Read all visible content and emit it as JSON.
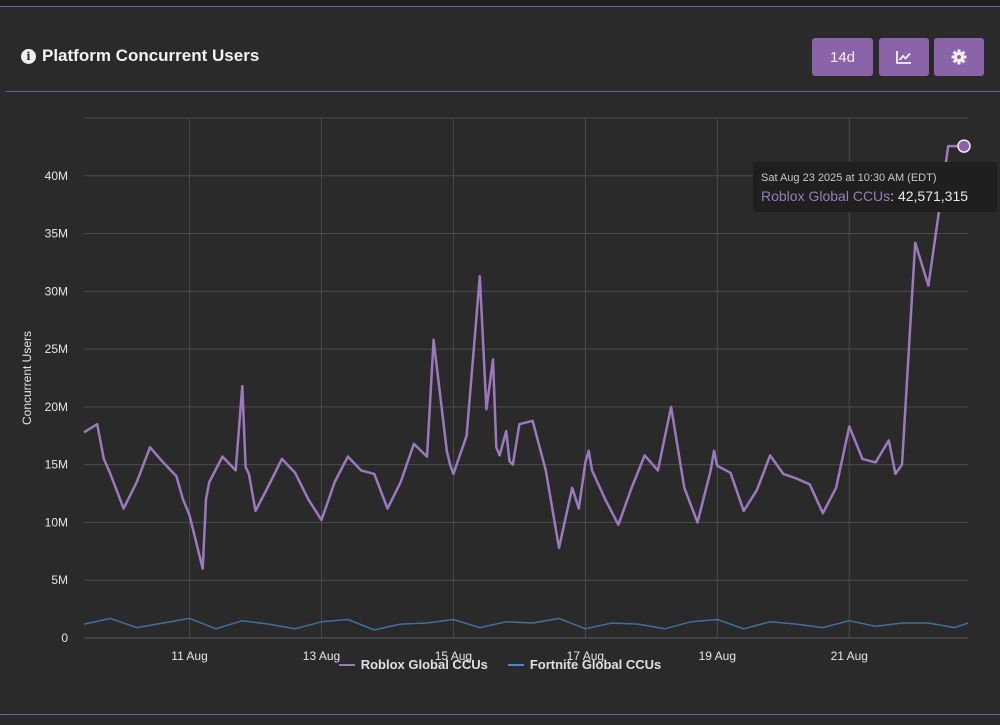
{
  "panel": {
    "title": "Platform Concurrent Users",
    "range_button": "14d",
    "icons": [
      "info-icon",
      "line-chart-icon",
      "gear-icon"
    ]
  },
  "tooltip": {
    "date": "Sat Aug 23 2025 at 10:30 AM (EDT)",
    "series": "Roblox Global CCUs",
    "value": "42,571,315"
  },
  "colors": {
    "roblox": "#9c79bf",
    "fortnite": "#4a86c8",
    "accent": "#8a63a8"
  },
  "chart_data": {
    "type": "line",
    "title": "",
    "xlabel": "",
    "ylabel": "Concurrent Users",
    "x_ticks": [
      "11 Aug",
      "13 Aug",
      "15 Aug",
      "17 Aug",
      "19 Aug",
      "21 Aug"
    ],
    "y_ticks": [
      "0",
      "5M",
      "10M",
      "15M",
      "20M",
      "25M",
      "30M",
      "35M",
      "40M"
    ],
    "xlim": [
      9.4,
      22.8
    ],
    "ylim": [
      0,
      45
    ],
    "y_unit": "millions",
    "grid": true,
    "legend_position": "bottom",
    "series": [
      {
        "name": "Roblox Global CCUs",
        "x": [
          9.4,
          9.6,
          9.7,
          9.8,
          10.0,
          10.2,
          10.4,
          10.6,
          10.8,
          10.9,
          11.0,
          11.2,
          11.25,
          11.3,
          11.5,
          11.7,
          11.8,
          11.85,
          11.9,
          12.0,
          12.2,
          12.4,
          12.6,
          12.8,
          13.0,
          13.2,
          13.4,
          13.6,
          13.8,
          14.0,
          14.2,
          14.4,
          14.6,
          14.7,
          14.9,
          14.95,
          15.0,
          15.2,
          15.4,
          15.5,
          15.6,
          15.65,
          15.7,
          15.8,
          15.85,
          15.9,
          16.0,
          16.2,
          16.4,
          16.6,
          16.8,
          16.9,
          17.0,
          17.05,
          17.1,
          17.3,
          17.5,
          17.7,
          17.9,
          18.1,
          18.3,
          18.5,
          18.7,
          18.9,
          18.95,
          19.0,
          19.2,
          19.4,
          19.6,
          19.8,
          20.0,
          20.2,
          20.4,
          20.6,
          20.8,
          21.0,
          21.2,
          21.4,
          21.6,
          21.7,
          21.8,
          22.0,
          22.2,
          22.4,
          22.5,
          22.6,
          22.65,
          22.7,
          22.75,
          22.8
        ],
        "values": [
          17.8,
          18.5,
          15.5,
          14.2,
          11.2,
          13.5,
          16.5,
          15.2,
          14.0,
          12.0,
          10.6,
          6.0,
          12.0,
          13.5,
          15.7,
          14.5,
          21.8,
          14.8,
          14.2,
          11.0,
          13.2,
          15.5,
          14.3,
          12.0,
          10.2,
          13.5,
          15.7,
          14.5,
          14.2,
          11.2,
          13.5,
          16.8,
          15.7,
          25.8,
          16.2,
          15.0,
          14.2,
          17.5,
          31.3,
          19.8,
          24.1,
          16.5,
          15.8,
          17.9,
          15.3,
          15.0,
          18.5,
          18.8,
          14.5,
          7.8,
          13.0,
          11.2,
          15.2,
          16.2,
          14.5,
          12.0,
          9.8,
          13.0,
          15.8,
          14.5,
          20.0,
          13.0,
          10.0,
          14.5,
          16.2,
          14.9,
          14.3,
          11.0,
          12.8,
          15.8,
          14.2,
          13.8,
          13.3,
          10.8,
          13.0,
          18.3,
          15.5,
          15.2,
          17.1,
          14.2,
          15.0,
          34.2,
          30.5,
          38.5,
          42.57,
          42.57,
          42.57,
          42.57,
          42.57,
          42.57
        ]
      },
      {
        "name": "Fortnite Global CCUs",
        "x": [
          9.4,
          9.8,
          10.2,
          10.6,
          11.0,
          11.4,
          11.8,
          12.2,
          12.6,
          13.0,
          13.4,
          13.8,
          14.2,
          14.6,
          15.0,
          15.4,
          15.8,
          16.2,
          16.6,
          17.0,
          17.4,
          17.8,
          18.2,
          18.6,
          19.0,
          19.4,
          19.8,
          20.2,
          20.6,
          21.0,
          21.4,
          21.8,
          22.2,
          22.6,
          22.8
        ],
        "values": [
          1.2,
          1.7,
          0.9,
          1.3,
          1.7,
          0.8,
          1.5,
          1.2,
          0.8,
          1.4,
          1.6,
          0.7,
          1.2,
          1.3,
          1.6,
          0.9,
          1.4,
          1.3,
          1.7,
          0.8,
          1.3,
          1.2,
          0.8,
          1.4,
          1.6,
          0.8,
          1.4,
          1.2,
          0.9,
          1.5,
          1.0,
          1.3,
          1.3,
          0.9,
          1.3
        ]
      }
    ]
  }
}
